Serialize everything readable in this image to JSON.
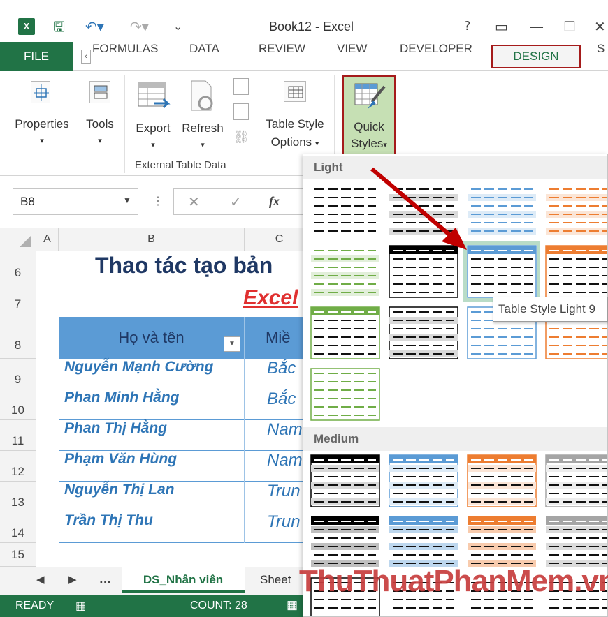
{
  "window": {
    "title": "Book12 - Excel",
    "logo": "X",
    "help": "?",
    "ribbon_display": "▭",
    "minimize": "—",
    "maximize": "☐",
    "close": "✕"
  },
  "tabs": {
    "file": "FILE",
    "items": [
      "FORMULAS",
      "DATA",
      "REVIEW",
      "VIEW",
      "DEVELOPER"
    ],
    "design": "DESIGN",
    "more": "S"
  },
  "ribbon": {
    "properties": "Properties",
    "tools": "Tools",
    "export": "Export",
    "refresh": "Refresh",
    "table_style_options_1": "Table Style",
    "table_style_options_2": "Options",
    "quick_styles_1": "Quick",
    "quick_styles_2": "Styles",
    "group_external": "External Table Data"
  },
  "formula_bar": {
    "name_box": "B8",
    "cancel": "✕",
    "enter": "✓",
    "fx": "fx"
  },
  "grid": {
    "col_a": "A",
    "col_b": "B",
    "col_c": "C",
    "rows": [
      "6",
      "7",
      "8",
      "9",
      "10",
      "11",
      "12",
      "13",
      "14",
      "15"
    ],
    "title": "Thao tác tạo bản",
    "subtitle": "Excel",
    "header_b": "Họ và tên",
    "header_c": "Miề",
    "data": [
      {
        "name": "Nguyễn  Mạnh Cường",
        "region": "Bắc"
      },
      {
        "name": "Phan  Minh Hằng",
        "region": "Bắc"
      },
      {
        "name": "Phan  Thị Hằng",
        "region": "Nam"
      },
      {
        "name": "Phạm  Văn Hùng",
        "region": "Nam"
      },
      {
        "name": "Nguyễn  Thị Lan",
        "region": "Trun"
      },
      {
        "name": "Trần  Thị Thu",
        "region": "Trun"
      }
    ]
  },
  "sheets": {
    "nav_prev": "◀",
    "nav_next": "▶",
    "nav_more": "...",
    "active": "DS_Nhân viên",
    "other": "Sheet"
  },
  "status": {
    "ready": "READY",
    "count": "COUNT: 28"
  },
  "gallery": {
    "light": "Light",
    "medium": "Medium",
    "tooltip": "Table Style Light 9"
  },
  "watermark": "ThuThuatPhanMem.vn",
  "colors": {
    "excel_green": "#217346",
    "highlight_red": "#a51b1b",
    "table_blue": "#5b9bd5",
    "title_navy": "#1f3864",
    "subtitle_red": "#e03030",
    "orange": "#ed7d31",
    "green_style": "#70ad47"
  }
}
